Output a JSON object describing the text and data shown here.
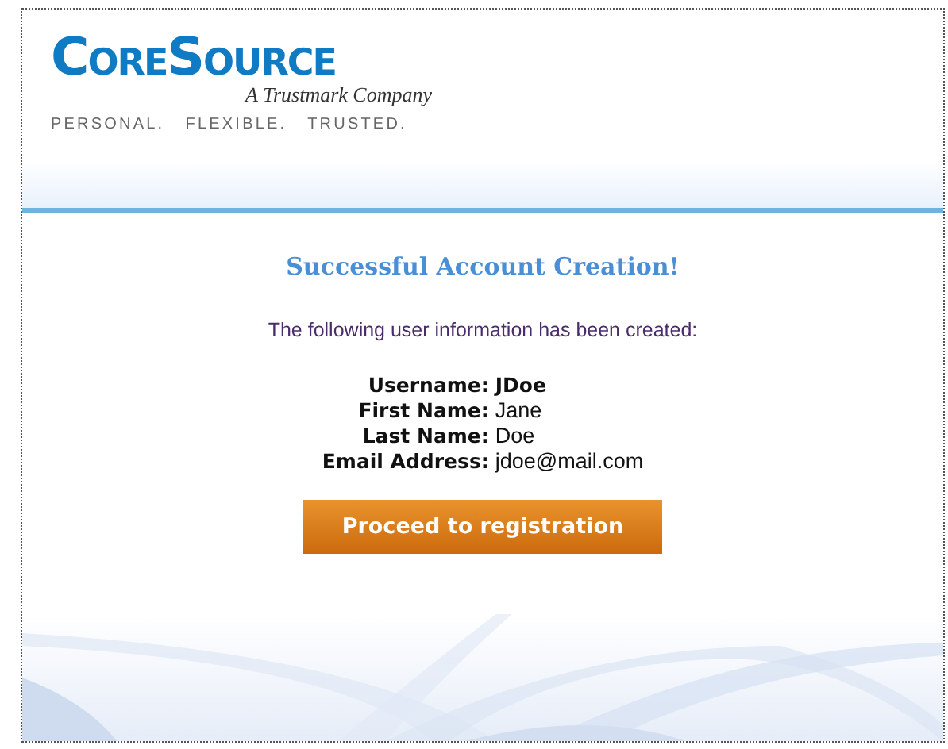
{
  "logo": {
    "name": "CoreSource",
    "subtitle": "A Trustmark Company",
    "tagline": "PERSONAL.   FLEXIBLE.   TRUSTED."
  },
  "title": "Successful Account Creation!",
  "message": "The following user information has been created:",
  "fields": [
    {
      "label": "Username:",
      "value": "JDoe",
      "bold": true
    },
    {
      "label": "First Name:",
      "value": "Jane",
      "bold": false
    },
    {
      "label": "Last Name:",
      "value": "Doe",
      "bold": false
    },
    {
      "label": "Email Address:",
      "value": "jdoe@mail.com",
      "bold": false
    }
  ],
  "button": "Proceed to registration"
}
